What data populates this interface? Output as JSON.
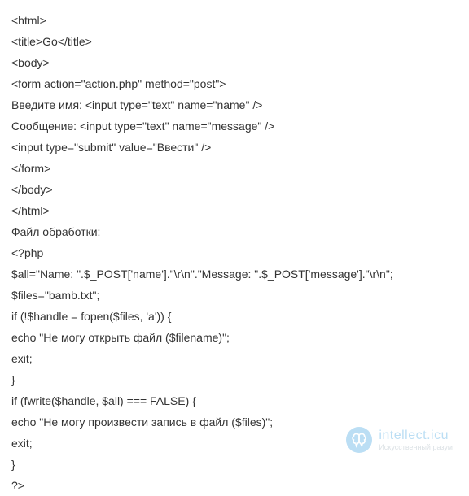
{
  "code": {
    "lines": [
      "<html>",
      "<title>Go</title>",
      "<body>",
      "<form action=\"action.php\" method=\"post\">",
      "Введите имя: <input type=\"text\" name=\"name\" />",
      "Сообщение: <input type=\"text\" name=\"message\" />",
      "<input type=\"submit\" value=\"Ввести\" />",
      "</form>",
      "</body>",
      "</html>",
      "Файл обработки:",
      "<?php",
      "$all=\"Name: \".$_POST['name'].\"\\r\\n\".\"Message: \".$_POST['message'].\"\\r\\n\";",
      "$files=\"bamb.txt\";",
      "if (!$handle = fopen($files, 'a')) {",
      "echo \"Не могу открыть файл ($filename)\";",
      "exit;",
      "}",
      "if (fwrite($handle, $all) === FALSE) {",
      "echo \"Не могу произвести запись в файл ($files)\";",
      "exit;",
      "}",
      "?>"
    ]
  },
  "watermark": {
    "brand": "intellect.icu",
    "sub": "Искусственный разум"
  }
}
